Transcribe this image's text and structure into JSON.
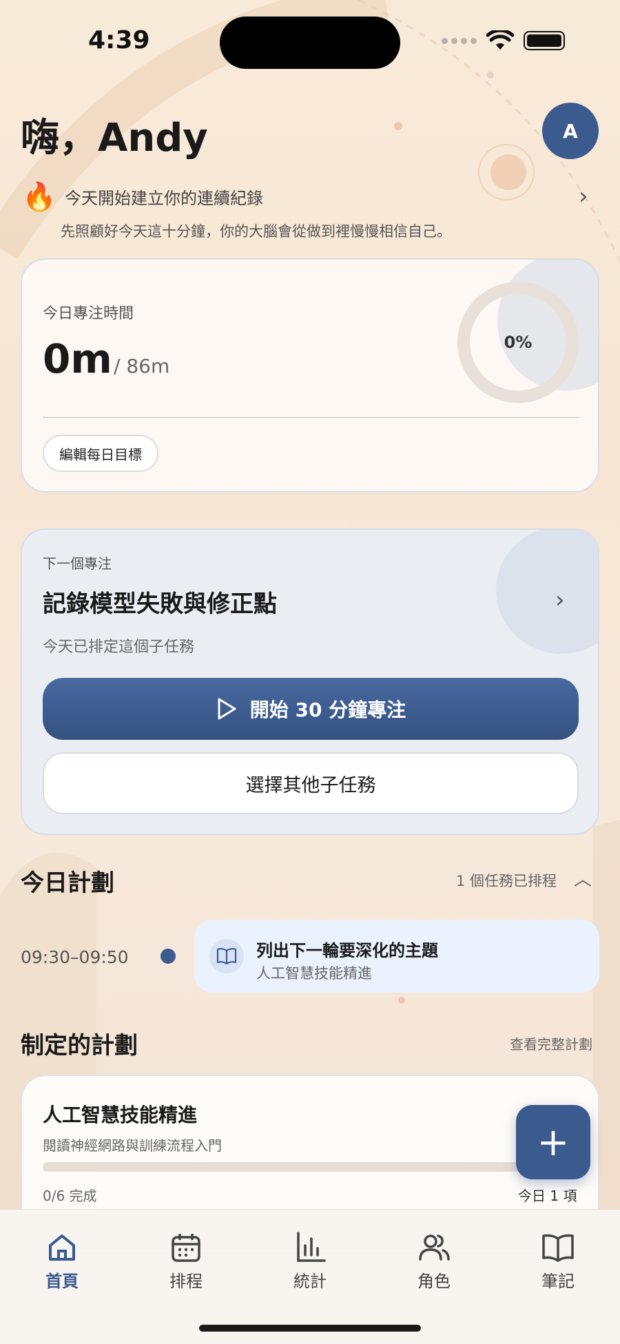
{
  "status_bar": {
    "time": "4:39"
  },
  "header": {
    "greeting": "嗨，Andy",
    "avatar_letter": "A"
  },
  "streak": {
    "icon": "🔥",
    "title": "今天開始建立你的連續紀錄",
    "subtitle": "先照顧好今天這十分鐘，你的大腦會從做到裡慢慢相信自己。"
  },
  "focus": {
    "label": "今日專注時間",
    "value": "0m",
    "goal": "/ 86m",
    "percent_label": "0%",
    "progress": 0,
    "edit_button": "編輯每日目標"
  },
  "next_focus": {
    "label": "下一個專注",
    "title": "記錄模型失敗與修正點",
    "subtitle": "今天已排定這個子任務",
    "start_button": "開始 30 分鐘專注",
    "choose_button": "選擇其他子任務"
  },
  "today_plan": {
    "title": "今日計劃",
    "count": "1 個任務已排程",
    "items": [
      {
        "time": "09:30–09:50",
        "title": "列出下一輪要深化的主題",
        "subtitle": "人工智慧技能精進"
      }
    ]
  },
  "plans": {
    "title": "制定的計劃",
    "link": "查看完整計劃",
    "items": [
      {
        "title": "人工智慧技能精進",
        "subtitle": "閱讀神經網路與訓練流程入門",
        "progress_text": "0/6 完成",
        "progress": 0,
        "today_count": "今日 1 項"
      }
    ]
  },
  "fab": {
    "label": "+"
  },
  "tabs": [
    {
      "label": "首頁",
      "icon": "home-icon",
      "active": true
    },
    {
      "label": "排程",
      "icon": "calendar-icon",
      "active": false
    },
    {
      "label": "統計",
      "icon": "stats-icon",
      "active": false
    },
    {
      "label": "角色",
      "icon": "people-icon",
      "active": false
    },
    {
      "label": "筆記",
      "icon": "book-icon",
      "active": false
    }
  ],
  "colors": {
    "accent": "#3b5a8e",
    "background": "#f7e6d4",
    "task_bg": "#eaf2fd"
  }
}
